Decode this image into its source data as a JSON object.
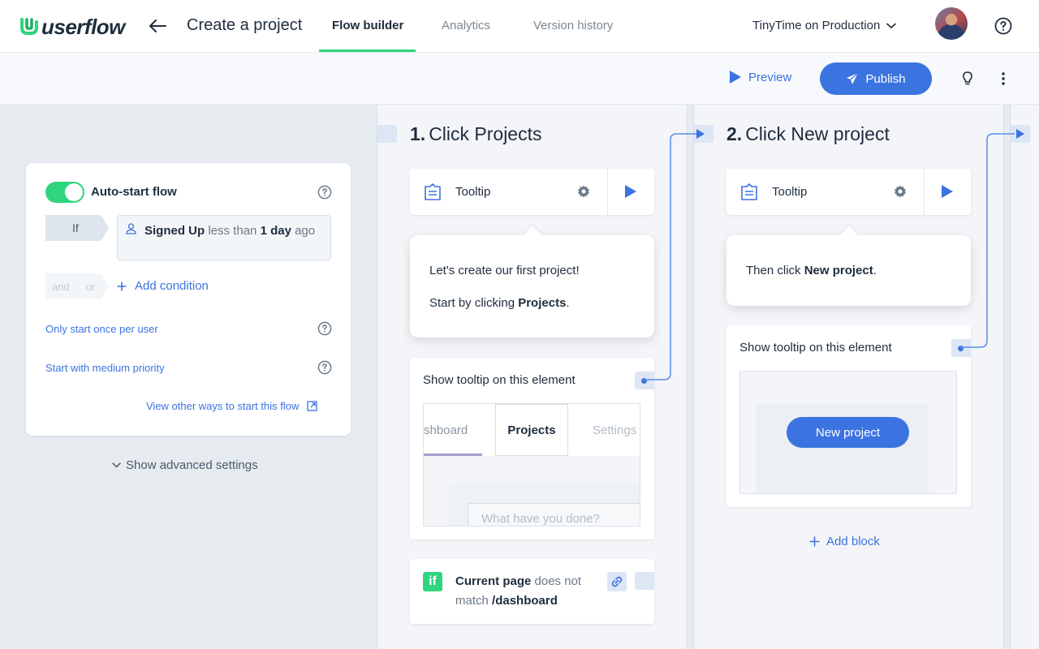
{
  "app": {
    "name": "userflow"
  },
  "header": {
    "title": "Create a project",
    "tabs": [
      {
        "label": "Flow builder",
        "active": true
      },
      {
        "label": "Analytics",
        "active": false
      },
      {
        "label": "Version history",
        "active": false
      }
    ],
    "environment": "TinyTime on Production"
  },
  "actions": {
    "preview": "Preview",
    "publish": "Publish"
  },
  "settings": {
    "autostart_label": "Auto-start flow",
    "autostart_on": true,
    "if_label": "If",
    "condition": {
      "attr": "Signed Up",
      "op": "less than",
      "value": "1 day",
      "suffix": "ago"
    },
    "and_label": "and",
    "or_label": "or",
    "add_condition": "Add condition",
    "once_per_user": "Only start once per user",
    "priority": "Start with medium priority",
    "view_other": "View other ways to start this flow",
    "advanced": "Show advanced settings"
  },
  "steps": [
    {
      "number": "1.",
      "title": "Click Projects",
      "block_type": "Tooltip",
      "tooltip_line1": "Let's create our first project!",
      "tooltip_line2_pre": "Start by clicking ",
      "tooltip_line2_bold": "Projects",
      "tooltip_line2_post": ".",
      "target_label": "Show tooltip on this element",
      "preview_tabs": [
        "shboard",
        "Projects",
        "Settings"
      ],
      "preview_placeholder": "What have you done?",
      "condition": {
        "attr": "Current page",
        "op": "does not match",
        "value": "/dashboard"
      }
    },
    {
      "number": "2.",
      "title": "Click New project",
      "block_type": "Tooltip",
      "tooltip_pre": "Then click ",
      "tooltip_bold": "New project",
      "tooltip_post": ".",
      "target_label": "Show tooltip on this element",
      "preview_button": "New project",
      "add_block": "Add block"
    }
  ],
  "colors": {
    "accent": "#3b73e0",
    "green": "#2fd47e",
    "text": "#1f2d3d",
    "muted": "#7b8794"
  }
}
